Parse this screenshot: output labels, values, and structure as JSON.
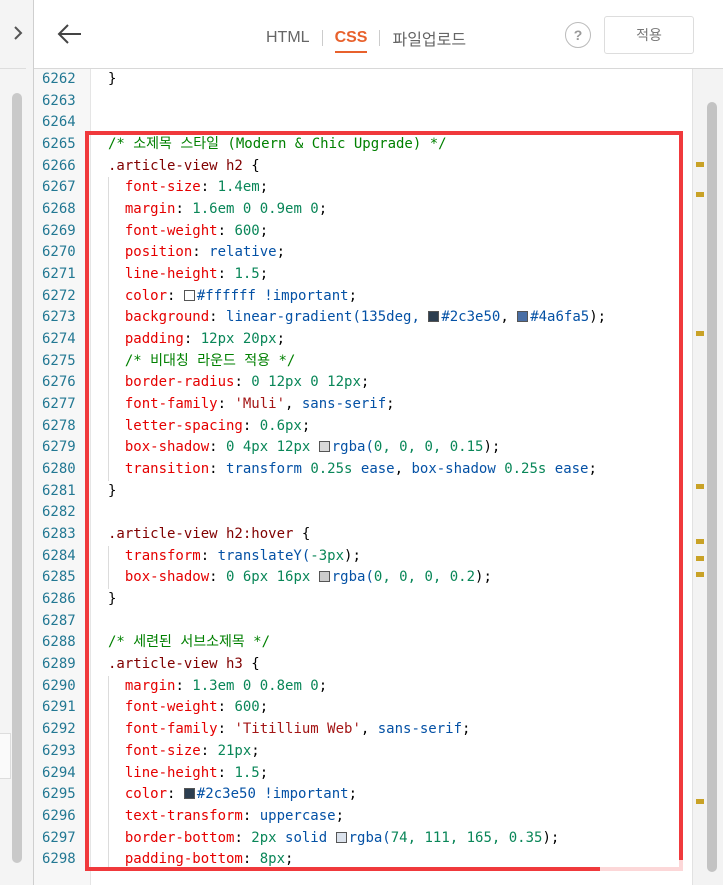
{
  "header": {
    "tabs": [
      {
        "label": "HTML",
        "active": false
      },
      {
        "label": "CSS",
        "active": true
      },
      {
        "label": "파일업로드",
        "active": false
      }
    ],
    "help_label": "?",
    "apply_label": "적용"
  },
  "colors": {
    "accent": "#e8612c",
    "highlight_border": "#f0393c"
  },
  "icons": [
    "chevron-right-icon",
    "back-arrow-icon",
    "help-icon"
  ],
  "editor": {
    "lines": [
      {
        "n": "6262",
        "t": [
          [
            "}",
            "pun"
          ]
        ]
      },
      {
        "n": "6263",
        "t": []
      },
      {
        "n": "6264",
        "t": []
      },
      {
        "n": "6265",
        "t": [
          [
            "/* 소제목 스타일 (Modern & Chic Upgrade) */",
            "cm"
          ]
        ]
      },
      {
        "n": "6266",
        "t": [
          [
            ".article-view h2",
            "sel"
          ],
          [
            " {",
            "pun"
          ]
        ]
      },
      {
        "n": "6267",
        "t": [
          [
            "  font-size",
            "prop"
          ],
          [
            ": ",
            "pun"
          ],
          [
            "1.4em",
            "num"
          ],
          [
            ";",
            "pun"
          ]
        ]
      },
      {
        "n": "6268",
        "t": [
          [
            "  margin",
            "prop"
          ],
          [
            ": ",
            "pun"
          ],
          [
            "1.6em 0 0.9em 0",
            "num"
          ],
          [
            ";",
            "pun"
          ]
        ]
      },
      {
        "n": "6269",
        "t": [
          [
            "  font-weight",
            "prop"
          ],
          [
            ": ",
            "pun"
          ],
          [
            "600",
            "num"
          ],
          [
            ";",
            "pun"
          ]
        ]
      },
      {
        "n": "6270",
        "t": [
          [
            "  position",
            "prop"
          ],
          [
            ": ",
            "pun"
          ],
          [
            "relative",
            "val"
          ],
          [
            ";",
            "pun"
          ]
        ]
      },
      {
        "n": "6271",
        "t": [
          [
            "  line-height",
            "prop"
          ],
          [
            ": ",
            "pun"
          ],
          [
            "1.5",
            "num"
          ],
          [
            ";",
            "pun"
          ]
        ]
      },
      {
        "n": "6272",
        "t": [
          [
            "  color",
            "prop"
          ],
          [
            ": ",
            "pun"
          ],
          [
            "#ffffff",
            "sw"
          ],
          [
            "#ffffff !important",
            "val"
          ],
          [
            ";",
            "pun"
          ]
        ]
      },
      {
        "n": "6273",
        "t": [
          [
            "  background",
            "prop"
          ],
          [
            ": ",
            "pun"
          ],
          [
            "linear-gradient(135deg, ",
            "val"
          ],
          [
            "#2c3e50",
            "sw"
          ],
          [
            "#2c3e50",
            "val"
          ],
          [
            ", ",
            "pun"
          ],
          [
            "#4a6fa5",
            "sw"
          ],
          [
            "#4a6fa5",
            "val"
          ],
          [
            ");",
            "pun"
          ]
        ]
      },
      {
        "n": "6274",
        "t": [
          [
            "  padding",
            "prop"
          ],
          [
            ": ",
            "pun"
          ],
          [
            "12px 20px",
            "num"
          ],
          [
            ";",
            "pun"
          ]
        ]
      },
      {
        "n": "6275",
        "t": [
          [
            "  /* 비대칭 라운드 적용 */",
            "cm"
          ]
        ]
      },
      {
        "n": "6276",
        "t": [
          [
            "  border-radius",
            "prop"
          ],
          [
            ": ",
            "pun"
          ],
          [
            "0 12px 0 12px",
            "num"
          ],
          [
            ";",
            "pun"
          ]
        ]
      },
      {
        "n": "6277",
        "t": [
          [
            "  font-family",
            "prop"
          ],
          [
            ": ",
            "pun"
          ],
          [
            "'Muli'",
            "str"
          ],
          [
            ", ",
            "pun"
          ],
          [
            "sans-serif",
            "val"
          ],
          [
            ";",
            "pun"
          ]
        ]
      },
      {
        "n": "6278",
        "t": [
          [
            "  letter-spacing",
            "prop"
          ],
          [
            ": ",
            "pun"
          ],
          [
            "0.6px",
            "num"
          ],
          [
            ";",
            "pun"
          ]
        ]
      },
      {
        "n": "6279",
        "t": [
          [
            "  box-shadow",
            "prop"
          ],
          [
            ": ",
            "pun"
          ],
          [
            "0 4px 12px ",
            "num"
          ],
          [
            "#d9d9d9",
            "sw"
          ],
          [
            "rgba(",
            "val"
          ],
          [
            "0, 0, 0, 0.15",
            "num"
          ],
          [
            ");",
            "pun"
          ]
        ]
      },
      {
        "n": "6280",
        "t": [
          [
            "  transition",
            "prop"
          ],
          [
            ": ",
            "pun"
          ],
          [
            "transform ",
            "val"
          ],
          [
            "0.25s ",
            "num"
          ],
          [
            "ease",
            "val"
          ],
          [
            ", ",
            "pun"
          ],
          [
            "box-shadow ",
            "val"
          ],
          [
            "0.25s ",
            "num"
          ],
          [
            "ease",
            "val"
          ],
          [
            ";",
            "pun"
          ]
        ]
      },
      {
        "n": "6281",
        "t": [
          [
            "}",
            "pun"
          ]
        ]
      },
      {
        "n": "6282",
        "t": []
      },
      {
        "n": "6283",
        "t": [
          [
            ".article-view h2:hover",
            "sel"
          ],
          [
            " {",
            "pun"
          ]
        ]
      },
      {
        "n": "6284",
        "t": [
          [
            "  transform",
            "prop"
          ],
          [
            ": ",
            "pun"
          ],
          [
            "translateY(",
            "val"
          ],
          [
            "-3px",
            "num"
          ],
          [
            ");",
            "pun"
          ]
        ]
      },
      {
        "n": "6285",
        "t": [
          [
            "  box-shadow",
            "prop"
          ],
          [
            ": ",
            "pun"
          ],
          [
            "0 6px 16px ",
            "num"
          ],
          [
            "#cccccc",
            "sw"
          ],
          [
            "rgba(",
            "val"
          ],
          [
            "0, 0, 0, 0.2",
            "num"
          ],
          [
            ");",
            "pun"
          ]
        ]
      },
      {
        "n": "6286",
        "t": [
          [
            "}",
            "pun"
          ]
        ]
      },
      {
        "n": "6287",
        "t": []
      },
      {
        "n": "6288",
        "t": [
          [
            "/* 세련된 서브소제목 */",
            "cm"
          ]
        ]
      },
      {
        "n": "6289",
        "t": [
          [
            ".article-view h3",
            "sel"
          ],
          [
            " {",
            "pun"
          ]
        ]
      },
      {
        "n": "6290",
        "t": [
          [
            "  margin",
            "prop"
          ],
          [
            ": ",
            "pun"
          ],
          [
            "1.3em 0 0.8em 0",
            "num"
          ],
          [
            ";",
            "pun"
          ]
        ]
      },
      {
        "n": "6291",
        "t": [
          [
            "  font-weight",
            "prop"
          ],
          [
            ": ",
            "pun"
          ],
          [
            "600",
            "num"
          ],
          [
            ";",
            "pun"
          ]
        ]
      },
      {
        "n": "6292",
        "t": [
          [
            "  font-family",
            "prop"
          ],
          [
            ": ",
            "pun"
          ],
          [
            "'Titillium Web'",
            "str"
          ],
          [
            ", ",
            "pun"
          ],
          [
            "sans-serif",
            "val"
          ],
          [
            ";",
            "pun"
          ]
        ]
      },
      {
        "n": "6293",
        "t": [
          [
            "  font-size",
            "prop"
          ],
          [
            ": ",
            "pun"
          ],
          [
            "21px",
            "num"
          ],
          [
            ";",
            "pun"
          ]
        ]
      },
      {
        "n": "6294",
        "t": [
          [
            "  line-height",
            "prop"
          ],
          [
            ": ",
            "pun"
          ],
          [
            "1.5",
            "num"
          ],
          [
            ";",
            "pun"
          ]
        ]
      },
      {
        "n": "6295",
        "t": [
          [
            "  color",
            "prop"
          ],
          [
            ": ",
            "pun"
          ],
          [
            "#2c3e50",
            "sw"
          ],
          [
            "#2c3e50 !important",
            "val"
          ],
          [
            ";",
            "pun"
          ]
        ]
      },
      {
        "n": "6296",
        "t": [
          [
            "  text-transform",
            "prop"
          ],
          [
            ": ",
            "pun"
          ],
          [
            "uppercase",
            "val"
          ],
          [
            ";",
            "pun"
          ]
        ]
      },
      {
        "n": "6297",
        "t": [
          [
            "  border-bottom",
            "prop"
          ],
          [
            ": ",
            "pun"
          ],
          [
            "2px ",
            "num"
          ],
          [
            "solid ",
            "val"
          ],
          [
            "#dbe2ec",
            "sw"
          ],
          [
            "rgba(",
            "val"
          ],
          [
            "74, 111, 165, 0.35",
            "num"
          ],
          [
            ");",
            "pun"
          ]
        ]
      },
      {
        "n": "6298",
        "t": [
          [
            "  padding-bottom",
            "prop"
          ],
          [
            ": ",
            "pun"
          ],
          [
            "8px",
            "num"
          ],
          [
            ";",
            "pun"
          ]
        ]
      }
    ]
  }
}
